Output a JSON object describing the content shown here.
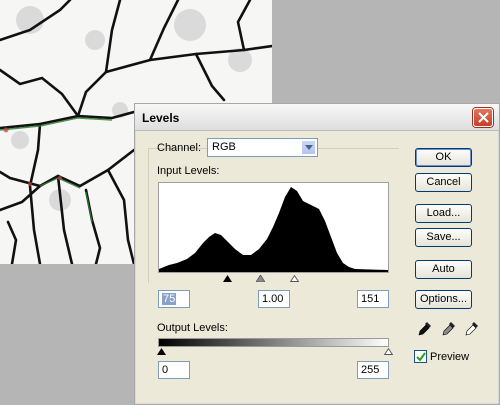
{
  "dialog": {
    "title": "Levels",
    "channel_label": "Channel:",
    "channel_value": "RGB",
    "input_levels_label": "Input Levels:",
    "input_black": "75",
    "input_gamma": "1.00",
    "input_white": "151",
    "output_levels_label": "Output Levels:",
    "output_black": "0",
    "output_white": "255",
    "preview_label": "Preview",
    "preview_checked": true
  },
  "buttons": {
    "ok": "OK",
    "cancel": "Cancel",
    "load": "Load...",
    "save": "Save...",
    "auto": "Auto",
    "options": "Options..."
  },
  "icons": {
    "close": "close-icon",
    "dropdown": "chevron-down-icon",
    "eyedroppers": [
      "black-eyedropper-icon",
      "gray-eyedropper-icon",
      "white-eyedropper-icon"
    ]
  },
  "colors": {
    "dialog_bg": "#ece9d8",
    "button_border": "#003c74",
    "close_button": "#c4402a"
  }
}
